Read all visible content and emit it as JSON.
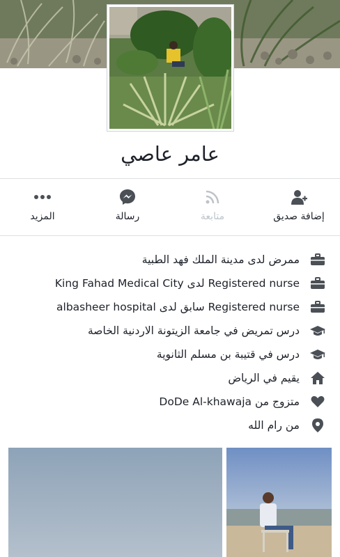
{
  "profile": {
    "name": "عامر عاصي"
  },
  "actions": [
    {
      "label": "إضافة صديق",
      "icon": "add-friend-icon",
      "enabled": true
    },
    {
      "label": "متابعة",
      "icon": "rss-follow-icon",
      "enabled": false
    },
    {
      "label": "رسالة",
      "icon": "messenger-icon",
      "enabled": true
    },
    {
      "label": "المزيد",
      "icon": "more-dots-icon",
      "enabled": true
    }
  ],
  "about": [
    {
      "icon": "briefcase-icon",
      "text": "ممرض لدى مدينة الملك فهد الطبية"
    },
    {
      "icon": "briefcase-icon",
      "text": "Registered nurse لدى King Fahad Medical City"
    },
    {
      "icon": "briefcase-icon",
      "text": "Registered nurse سابق لدى albasheer hospital"
    },
    {
      "icon": "graduation-cap-icon",
      "text": "درس تمريض في جامعة الزيتونة الاردنية الخاصة"
    },
    {
      "icon": "graduation-cap-icon",
      "text": "درس في قتيبة بن مسلم الثانوية"
    },
    {
      "icon": "home-icon",
      "text": "يقيم في الرياض"
    },
    {
      "icon": "heart-icon",
      "text": "متزوج من DoDe Al-khawaja"
    },
    {
      "icon": "location-pin-icon",
      "text": "من رام الله"
    }
  ],
  "colors": {
    "text": "#1d2129",
    "icon": "#4b4f56",
    "disabled": "#bec3c9",
    "divider": "#dddfe2"
  }
}
